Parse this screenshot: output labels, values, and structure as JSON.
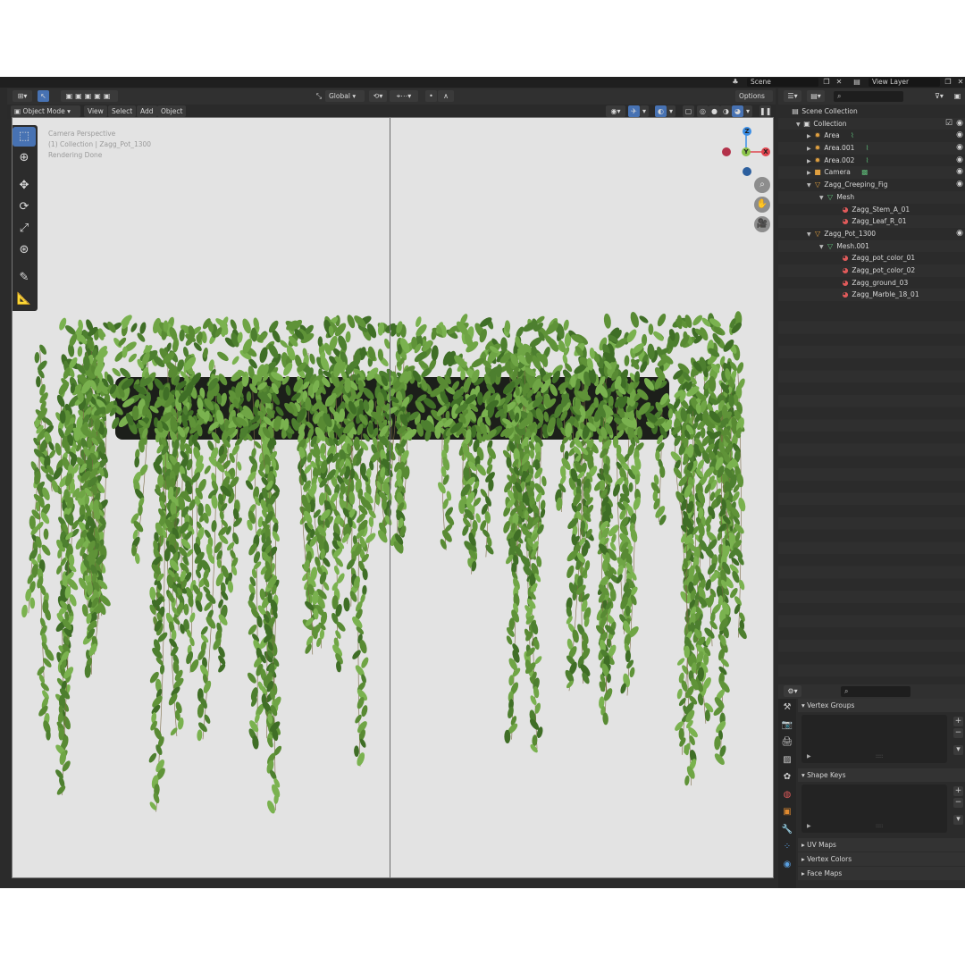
{
  "topbar": {
    "scene": "Scene",
    "view_layer": "View Layer"
  },
  "viewport_header": {
    "transform_orientation": "Global",
    "options": "Options",
    "mode": "Object Mode",
    "menus": [
      "View",
      "Select",
      "Add",
      "Object"
    ]
  },
  "viewport": {
    "info_line1": "Camera Perspective",
    "info_line2": "(1) Collection | Zagg_Pot_1300",
    "info_line3": "Rendering Done",
    "gizmo": {
      "x": "X",
      "y": "Y",
      "z": "Z"
    }
  },
  "outliner": {
    "rows": [
      {
        "label": "Scene Collection"
      },
      {
        "label": "Collection"
      },
      {
        "label": "Area"
      },
      {
        "label": "Area.001"
      },
      {
        "label": "Area.002"
      },
      {
        "label": "Camera"
      },
      {
        "label": "Zagg_Creeping_Fig"
      },
      {
        "label": "Mesh"
      },
      {
        "label": "Zagg_Stem_A_01"
      },
      {
        "label": "Zagg_Leaf_R_01"
      },
      {
        "label": "Zagg_Pot_1300"
      },
      {
        "label": "Mesh.001"
      },
      {
        "label": "Zagg_pot_color_01"
      },
      {
        "label": "Zagg_pot_color_02"
      },
      {
        "label": "Zagg_ground_03"
      },
      {
        "label": "Zagg_Marble_18_01"
      }
    ]
  },
  "properties": {
    "vertex_groups": "Vertex Groups",
    "shape_keys": "Shape Keys",
    "uv_maps": "UV Maps",
    "vertex_colors": "Vertex Colors",
    "face_maps": "Face Maps"
  },
  "colors": {
    "accent": "#4772b3",
    "axis_x": "#e0444e",
    "axis_y": "#8bc34a",
    "axis_z": "#3a8ee6",
    "leaf": "#5a8f3a"
  }
}
